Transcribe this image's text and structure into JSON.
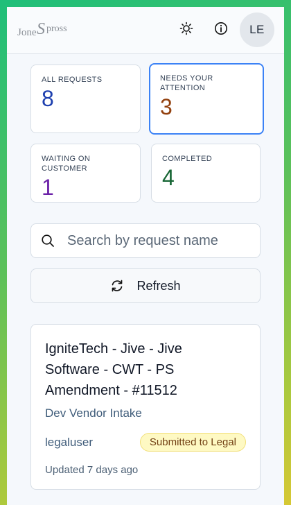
{
  "header": {
    "logo_text": "JonesSpross",
    "avatar_initials": "LE"
  },
  "stats": [
    {
      "label": "ALL REQUESTS",
      "value": "8"
    },
    {
      "label": "NEEDS YOUR ATTENTION",
      "value": "3"
    },
    {
      "label": "WAITING ON CUSTOMER",
      "value": "1"
    },
    {
      "label": "COMPLETED",
      "value": "4"
    }
  ],
  "search": {
    "placeholder": "Search by request name",
    "value": ""
  },
  "refresh": {
    "label": "Refresh"
  },
  "requests": [
    {
      "title": "IgniteTech - Jive - Jive Software - CWT - PS Amendment - #11512",
      "vendor": "Dev Vendor Intake",
      "user": "legaluser",
      "status": "Submitted to Legal",
      "updated": "Updated 7 days ago"
    }
  ],
  "colors": {
    "accent": "#3b82f6",
    "all_requests": "#1e40af",
    "needs_attention": "#92400e",
    "waiting": "#6b21a8",
    "completed": "#166534",
    "badge_bg": "#fef9c3"
  },
  "icons": {
    "theme": "sun-icon",
    "info": "info-icon",
    "search": "search-icon",
    "refresh": "refresh-icon"
  }
}
